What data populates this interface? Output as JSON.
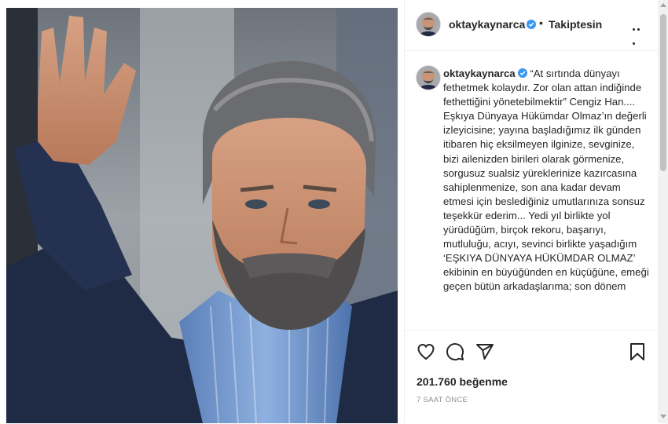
{
  "post": {
    "username": "oktaykaynarca",
    "follow_status": "Takiptesin",
    "separator": "•"
  },
  "caption": {
    "username": "oktaykaynarca",
    "text": "“At sırtında dünyayı fethetmek kolaydır. Zor olan attan indiğinde fethettiğini yönetebilmektir” Cengiz Han....\nEşkıya Dünyaya Hükümdar Olmaz’ın değerli izleyicisine; yayına başladığımız ilk günden itibaren hiç eksilmeyen ilginize, sevginize, bizi ailenizden birileri olarak görmenize, sorgusuz sualsiz yüreklerinize kazırcasına sahiplenmenize, son ana kadar devam etmesi için beslediğiniz umutlarınıza sonsuz teşekkür ederim... Yedi yıl birlikte yol yürüdüğüm, birçok rekoru, başarıyı, mutluluğu, acıyı, sevinci birlikte yaşadığım ‘EŞKIYA DÜNYAYA HÜKÜMDAR OLMAZ’ ekibinin en büyüğünden en küçüğüne, emeği geçen bütün arkadaşlarıma; son dönem"
  },
  "stats": {
    "likes": "201.760 beğenme",
    "time": "7 SAAT ÖNCE"
  },
  "icons": {
    "verified": "verified-badge-icon",
    "more": "more-options-icon",
    "like": "heart-icon",
    "comment": "comment-icon",
    "share": "share-icon",
    "save": "bookmark-icon"
  },
  "colors": {
    "verified_blue": "#3897f0",
    "text": "#262626",
    "muted": "#8e8e8e",
    "border": "#efefef"
  }
}
